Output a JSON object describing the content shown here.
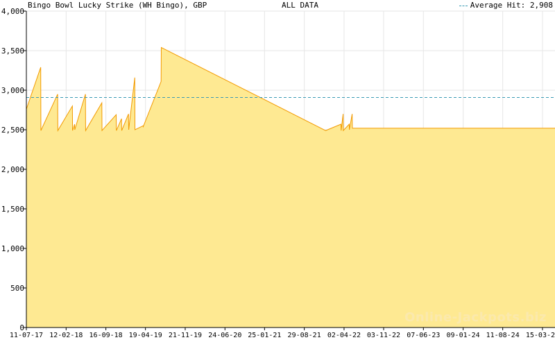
{
  "chart_data": {
    "type": "area",
    "title": "Bingo Bowl Lucky Strike (WH Bingo), GBP",
    "subtitle": "ALL DATA",
    "xlabel": "",
    "ylabel": "",
    "ylim": [
      0,
      4000
    ],
    "y_ticks": [
      0,
      500,
      1000,
      1500,
      2000,
      2500,
      3000,
      3500,
      4000
    ],
    "y_tick_labels": [
      "0",
      "500",
      "1,000",
      "1,500",
      "2,000",
      "2,500",
      "3,000",
      "3,500",
      "4,000"
    ],
    "x_tick_labels": [
      "11-07-17",
      "12-02-18",
      "16-09-18",
      "19-04-19",
      "21-11-19",
      "24-06-20",
      "25-01-21",
      "29-08-21",
      "02-04-22",
      "03-11-22",
      "07-06-23",
      "09-01-24",
      "11-08-24",
      "15-03-25"
    ],
    "grid": true,
    "legend_position": "top-right",
    "average_label": "Average Hit: 2,908",
    "average_value": 2908,
    "series": [
      {
        "name": "",
        "x": [
          "2017-07-11",
          "2017-09-27",
          "2017-09-28",
          "2017-12-28",
          "2017-12-29",
          "2018-03-18",
          "2018-03-19",
          "2018-03-30",
          "2018-03-31",
          "2018-05-28",
          "2018-05-29",
          "2018-08-25",
          "2018-08-26",
          "2018-11-11",
          "2018-11-12",
          "2018-12-10",
          "2018-12-11",
          "2019-01-17",
          "2019-01-18",
          "2019-02-20",
          "2019-02-21",
          "2019-04-06",
          "2019-04-07",
          "2019-07-13",
          "2019-07-14",
          "2021-12-23",
          "2022-03-16",
          "2022-03-17",
          "2022-03-28",
          "2022-03-29",
          "2022-04-30",
          "2022-05-01",
          "2022-05-16",
          "2022-05-17",
          "2022-06-26",
          "2022-06-27",
          "2025-05-22"
        ],
        "values": [
          2760,
          3290,
          2490,
          2950,
          2490,
          2800,
          2490,
          2570,
          2500,
          2950,
          2490,
          2840,
          2490,
          2690,
          2490,
          2640,
          2490,
          2700,
          2500,
          3160,
          2500,
          2550,
          2540,
          3110,
          3540,
          2490,
          2570,
          2490,
          2700,
          2490,
          2570,
          2500,
          2700,
          2520,
          2520,
          2520,
          2520
        ]
      }
    ],
    "colors": {
      "fill": "#fee992",
      "line": "#f29a00",
      "average": "#3a9ab4",
      "grid": "#e6e6e6",
      "axis": "#000000"
    }
  },
  "watermark": "Online-Jackpots.biz"
}
